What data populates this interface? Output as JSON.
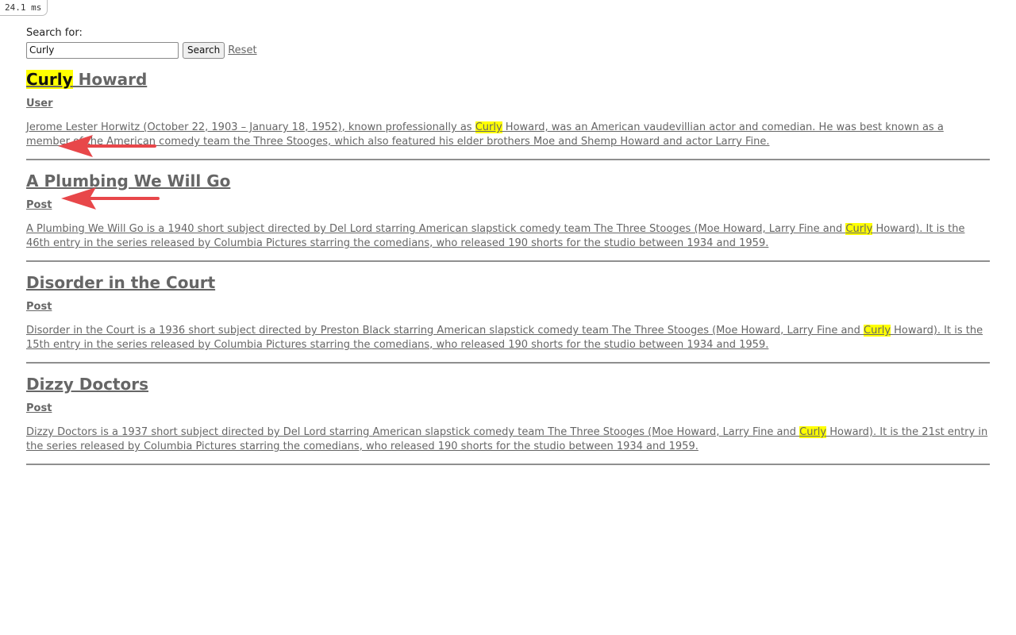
{
  "timing": "24.1 ms",
  "search": {
    "label": "Search for:",
    "value": "Curly",
    "button_label": "Search",
    "reset_label": "Reset"
  },
  "results": [
    {
      "title_highlight": "Curly",
      "title_rest": " Howard",
      "type": "User",
      "summary_before": "Jerome Lester Horwitz (October 22, 1903 – January 18, 1952), known professionally as ",
      "summary_highlight": "Curly",
      "summary_after": " Howard, was an American vaudevillian actor and comedian. He was best known as a member of the American comedy team the Three Stooges, which also featured his elder brothers Moe and Shemp Howard and actor Larry Fine.",
      "annotated": true
    },
    {
      "title": "A Plumbing We Will Go",
      "type": "Post",
      "summary_before": "A Plumbing We Will Go is a 1940 short subject directed by Del Lord starring American slapstick comedy team The Three Stooges (Moe Howard, Larry Fine and ",
      "summary_highlight": "Curly",
      "summary_after": " Howard). It is the 46th entry in the series released by Columbia Pictures starring the comedians, who released 190 shorts for the studio between 1934 and 1959.",
      "annotated": true
    },
    {
      "title": "Disorder in the Court",
      "type": "Post",
      "summary_before": "Disorder in the Court is a 1936 short subject directed by Preston Black starring American slapstick comedy team The Three Stooges (Moe Howard, Larry Fine and ",
      "summary_highlight": "Curly",
      "summary_after": " Howard). It is the 15th entry in the series released by Columbia Pictures starring the comedians, who released 190 shorts for the studio between 1934 and 1959.",
      "annotated": false
    },
    {
      "title": "Dizzy Doctors",
      "type": "Post",
      "summary_before": "Dizzy Doctors is a 1937 short subject directed by Del Lord starring American slapstick comedy team The Three Stooges (Moe Howard, Larry Fine and ",
      "summary_highlight": "Curly",
      "summary_after": " Howard). It is the 21st entry in the series released by Columbia Pictures starring the comedians, who released 190 shorts for the studio between 1934 and 1959.",
      "annotated": false
    }
  ],
  "colors": {
    "link": "#666666",
    "highlight": "#ffff00",
    "annotation_arrow": "#e8474a",
    "divider": "#8f8f8f"
  }
}
